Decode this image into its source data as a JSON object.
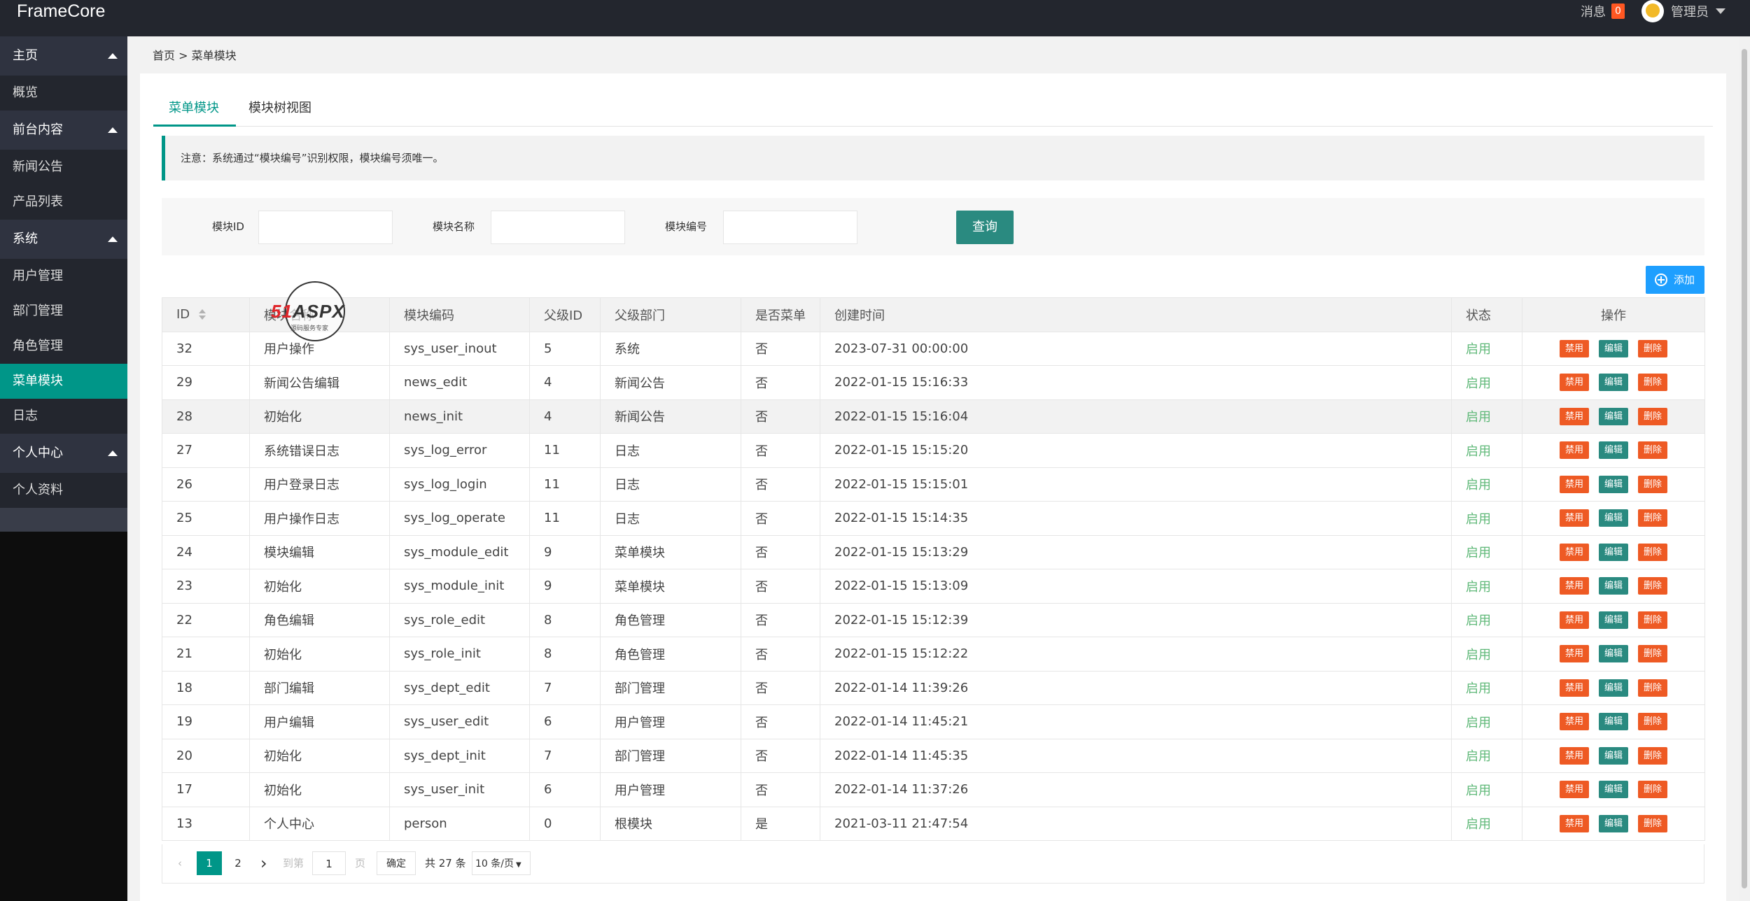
{
  "app": {
    "brand": "FrameCore"
  },
  "header": {
    "messages_label": "消息",
    "messages_count": "0",
    "user_label": "管理员"
  },
  "sidebar": {
    "groups": [
      {
        "label": "主页",
        "items": [
          "概览"
        ]
      },
      {
        "label": "前台内容",
        "items": [
          "新闻公告",
          "产品列表"
        ]
      },
      {
        "label": "系统",
        "items": [
          "用户管理",
          "部门管理",
          "角色管理",
          "菜单模块",
          "日志"
        ]
      },
      {
        "label": "个人中心",
        "items": [
          "个人资料"
        ]
      }
    ],
    "active": "菜单模块"
  },
  "breadcrumb": "首页 > 菜单模块",
  "tabs": [
    {
      "label": "菜单模块",
      "active": true
    },
    {
      "label": "模块树视图",
      "active": false
    }
  ],
  "notice": "注意：系统通过“模块编号”识别权限，模块编号须唯一。",
  "search": {
    "fields": [
      {
        "label": "模块ID",
        "value": ""
      },
      {
        "label": "模块名称",
        "value": ""
      },
      {
        "label": "模块编号",
        "value": ""
      }
    ],
    "query_button": "查询"
  },
  "add_button": "添加",
  "table": {
    "columns": [
      "ID",
      "模块名称",
      "模块编码",
      "父级ID",
      "父级部门",
      "是否菜单",
      "创建时间",
      "状态",
      "操作"
    ],
    "actions": [
      "禁用",
      "编辑",
      "删除"
    ],
    "rows": [
      {
        "id": "32",
        "name": "用户操作",
        "code": "sys_user_inout",
        "pid": "5",
        "parent": "系统",
        "menu": "否",
        "created": "2023-07-31 00:00:00",
        "status": "启用"
      },
      {
        "id": "29",
        "name": "新闻公告编辑",
        "code": "news_edit",
        "pid": "4",
        "parent": "新闻公告",
        "menu": "否",
        "created": "2022-01-15 15:16:33",
        "status": "启用"
      },
      {
        "id": "28",
        "name": "初始化",
        "code": "news_init",
        "pid": "4",
        "parent": "新闻公告",
        "menu": "否",
        "created": "2022-01-15 15:16:04",
        "status": "启用"
      },
      {
        "id": "27",
        "name": "系统错误日志",
        "code": "sys_log_error",
        "pid": "11",
        "parent": "日志",
        "menu": "否",
        "created": "2022-01-15 15:15:20",
        "status": "启用"
      },
      {
        "id": "26",
        "name": "用户登录日志",
        "code": "sys_log_login",
        "pid": "11",
        "parent": "日志",
        "menu": "否",
        "created": "2022-01-15 15:15:01",
        "status": "启用"
      },
      {
        "id": "25",
        "name": "用户操作日志",
        "code": "sys_log_operate",
        "pid": "11",
        "parent": "日志",
        "menu": "否",
        "created": "2022-01-15 15:14:35",
        "status": "启用"
      },
      {
        "id": "24",
        "name": "模块编辑",
        "code": "sys_module_edit",
        "pid": "9",
        "parent": "菜单模块",
        "menu": "否",
        "created": "2022-01-15 15:13:29",
        "status": "启用"
      },
      {
        "id": "23",
        "name": "初始化",
        "code": "sys_module_init",
        "pid": "9",
        "parent": "菜单模块",
        "menu": "否",
        "created": "2022-01-15 15:13:09",
        "status": "启用"
      },
      {
        "id": "22",
        "name": "角色编辑",
        "code": "sys_role_edit",
        "pid": "8",
        "parent": "角色管理",
        "menu": "否",
        "created": "2022-01-15 15:12:39",
        "status": "启用"
      },
      {
        "id": "21",
        "name": "初始化",
        "code": "sys_role_init",
        "pid": "8",
        "parent": "角色管理",
        "menu": "否",
        "created": "2022-01-15 15:12:22",
        "status": "启用"
      },
      {
        "id": "18",
        "name": "部门编辑",
        "code": "sys_dept_edit",
        "pid": "7",
        "parent": "部门管理",
        "menu": "否",
        "created": "2022-01-14 11:39:26",
        "status": "启用"
      },
      {
        "id": "19",
        "name": "用户编辑",
        "code": "sys_user_edit",
        "pid": "6",
        "parent": "用户管理",
        "menu": "否",
        "created": "2022-01-14 11:45:21",
        "status": "启用"
      },
      {
        "id": "20",
        "name": "初始化",
        "code": "sys_dept_init",
        "pid": "7",
        "parent": "部门管理",
        "menu": "否",
        "created": "2022-01-14 11:45:35",
        "status": "启用"
      },
      {
        "id": "17",
        "name": "初始化",
        "code": "sys_user_init",
        "pid": "6",
        "parent": "用户管理",
        "menu": "否",
        "created": "2022-01-14 11:37:26",
        "status": "启用"
      },
      {
        "id": "13",
        "name": "个人中心",
        "code": "person",
        "pid": "0",
        "parent": "根模块",
        "menu": "是",
        "created": "2021-03-11 21:47:54",
        "status": "启用"
      }
    ],
    "highlighted_row": 2
  },
  "pagination": {
    "pages": [
      "1",
      "2"
    ],
    "current": "1",
    "goto_label": "到第",
    "goto_value": "1",
    "page_unit": "页",
    "confirm": "确定",
    "total": "共 27 条",
    "page_size": "10 条/页"
  },
  "watermark": {
    "text_red": "51",
    "text_dark": "ASPX",
    "sub": "源码服务专家"
  },
  "colors": {
    "accent": "#009688",
    "sidebar": "#393d49",
    "topbar": "#23262e",
    "danger": "#ee5a24",
    "info": "#1e9fff",
    "status_on": "#5fb878"
  }
}
